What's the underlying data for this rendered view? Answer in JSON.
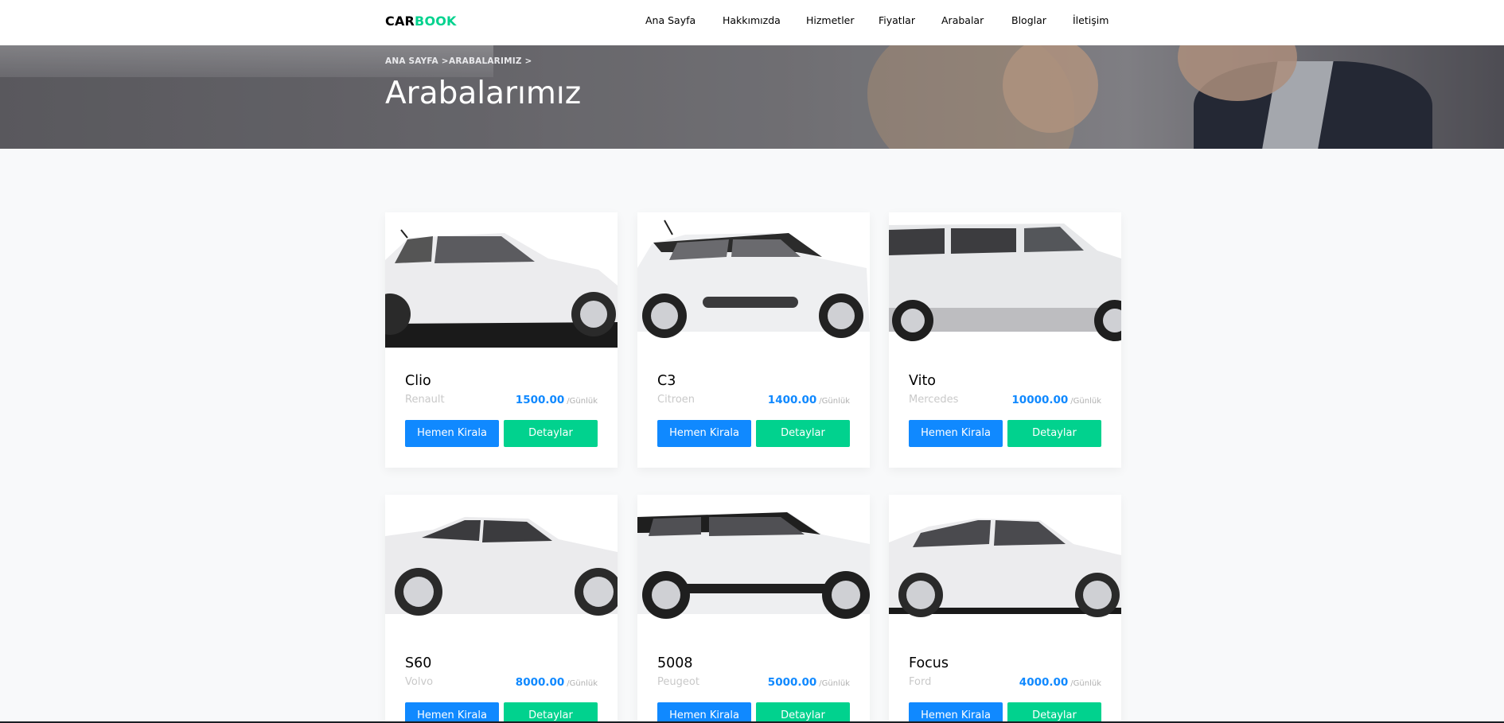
{
  "brand": {
    "part1": "CAR",
    "part2": "BOOK"
  },
  "nav": [
    {
      "label": "Ana Sayfa"
    },
    {
      "label": "Hakkımızda"
    },
    {
      "label": "Hizmetler"
    },
    {
      "label": "Fiyatlar"
    },
    {
      "label": "Arabalar"
    },
    {
      "label": "Bloglar"
    },
    {
      "label": "İletişim"
    }
  ],
  "hero": {
    "breadcrumb": [
      "ANA SAYFA",
      "ARABALARIMIZ"
    ],
    "breadcrumb_separator": ">",
    "title": "Arabalarımız"
  },
  "cars": [
    {
      "name": "Clio",
      "brand": "Renault",
      "price": "1500.00",
      "unit": "/Günlük",
      "rent_label": "Hemen Kirala",
      "detail_label": "Detaylar"
    },
    {
      "name": "C3",
      "brand": "Citroen",
      "price": "1400.00",
      "unit": "/Günlük",
      "rent_label": "Hemen Kirala",
      "detail_label": "Detaylar"
    },
    {
      "name": "Vito",
      "brand": "Mercedes",
      "price": "10000.00",
      "unit": "/Günlük",
      "rent_label": "Hemen Kirala",
      "detail_label": "Detaylar"
    },
    {
      "name": "S60",
      "brand": "Volvo",
      "price": "8000.00",
      "unit": "/Günlük",
      "rent_label": "Hemen Kirala",
      "detail_label": "Detaylar"
    },
    {
      "name": "5008",
      "brand": "Peugeot",
      "price": "5000.00",
      "unit": "/Günlük",
      "rent_label": "Hemen Kirala",
      "detail_label": "Detaylar"
    },
    {
      "name": "Focus",
      "brand": "Ford",
      "price": "4000.00",
      "unit": "/Günlük",
      "rent_label": "Hemen Kirala",
      "detail_label": "Detaylar"
    }
  ],
  "colors": {
    "accent_blue": "#1089ff",
    "accent_green": "#01d28e",
    "page_bg": "#f8f9fa"
  }
}
